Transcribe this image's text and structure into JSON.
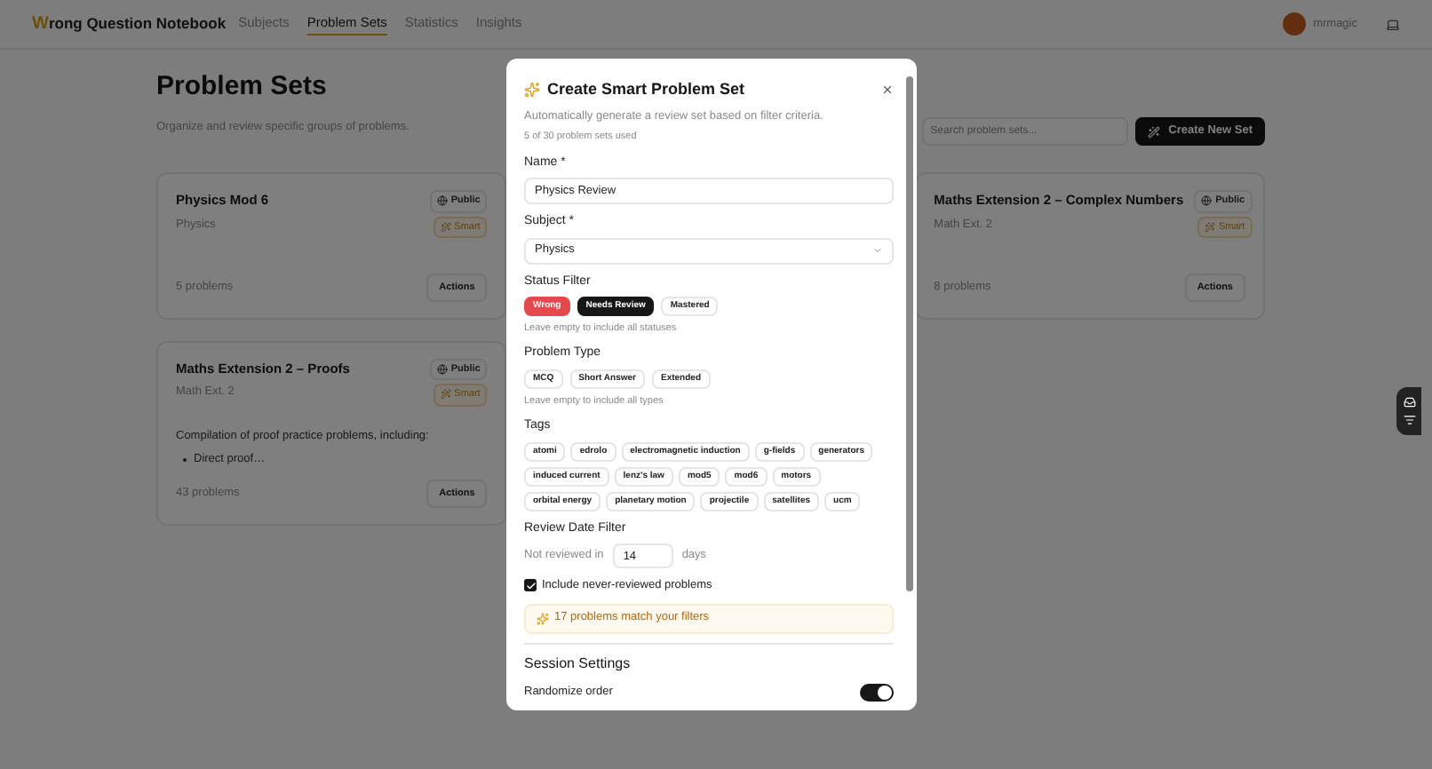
{
  "header": {
    "brand": "Wrong Question Notebook",
    "nav": [
      {
        "label": "Subjects",
        "selected": false
      },
      {
        "label": "Problem Sets",
        "selected": true
      },
      {
        "label": "Statistics",
        "selected": false
      },
      {
        "label": "Insights",
        "selected": false
      }
    ],
    "user": {
      "name": "mrmagic"
    }
  },
  "page": {
    "title": "Problem Sets",
    "subtitle": "Organize and review specific groups of problems.",
    "search": {
      "placeholder": "Search problem sets..."
    },
    "create_button": "Create New Set"
  },
  "cards": [
    {
      "title": "Physics Mod 6",
      "subject": "Physics",
      "visibility": "Public",
      "badge": "Smart",
      "count": "5 problems",
      "actions": "Actions"
    },
    {
      "title": "Maths Extension 2 – Complex Numbers",
      "subject": "Math Ext. 2",
      "visibility": "Public",
      "badge": "Smart",
      "count": "8 problems",
      "actions": "Actions"
    },
    {
      "title": "Maths Extension 2 – Proofs",
      "subject": "Math Ext. 2",
      "visibility": "Public",
      "badge": "Smart",
      "description": "Compilation of proof practice problems, including:",
      "bullets": [
        "Direct proof…"
      ],
      "count": "43 problems",
      "actions": "Actions"
    }
  ],
  "dialog": {
    "title": "Create Smart Problem Set",
    "description": "Automatically generate a review set based on filter criteria.",
    "usage": "5 of 30 problem sets used",
    "name": {
      "label": "Name *",
      "value": "Physics Review"
    },
    "subject": {
      "label": "Subject *",
      "value": "Physics"
    },
    "status_filter": {
      "label": "Status Filter",
      "hint": "Leave empty to include all statuses",
      "options": [
        {
          "label": "Wrong",
          "kind": "wrong",
          "selected": true
        },
        {
          "label": "Needs Review",
          "kind": "review",
          "selected": true
        },
        {
          "label": "Mastered",
          "kind": "mastered",
          "selected": false
        }
      ]
    },
    "problem_type": {
      "label": "Problem Type",
      "hint": "Leave empty to include all types",
      "options": [
        {
          "label": "MCQ",
          "selected": false
        },
        {
          "label": "Short Answer",
          "selected": false
        },
        {
          "label": "Extended",
          "selected": false
        }
      ]
    },
    "tags": {
      "label": "Tags",
      "options": [
        {
          "label": "atomi",
          "selected": false
        },
        {
          "label": "edrolo",
          "selected": false
        },
        {
          "label": "electromagnetic induction",
          "selected": false
        },
        {
          "label": "g-fields",
          "selected": false
        },
        {
          "label": "generators",
          "selected": false
        },
        {
          "label": "induced current",
          "selected": false
        },
        {
          "label": "lenz's law",
          "selected": false
        },
        {
          "label": "mod5",
          "selected": false
        },
        {
          "label": "mod6",
          "selected": false
        },
        {
          "label": "motors",
          "selected": false
        },
        {
          "label": "orbital energy",
          "selected": false
        },
        {
          "label": "planetary motion",
          "selected": false
        },
        {
          "label": "projectile",
          "selected": false
        },
        {
          "label": "satellites",
          "selected": false
        },
        {
          "label": "ucm",
          "selected": false
        }
      ]
    },
    "review_date": {
      "label": "Review Date Filter",
      "prefix": "Not reviewed in",
      "value": "14",
      "unit": "days"
    },
    "include_never": {
      "label": "Include never-reviewed problems",
      "checked": true
    },
    "match": "17 problems match your filters",
    "session": {
      "title": "Session Settings",
      "toggles": [
        {
          "label": "Randomize order",
          "on": true
        }
      ]
    }
  }
}
